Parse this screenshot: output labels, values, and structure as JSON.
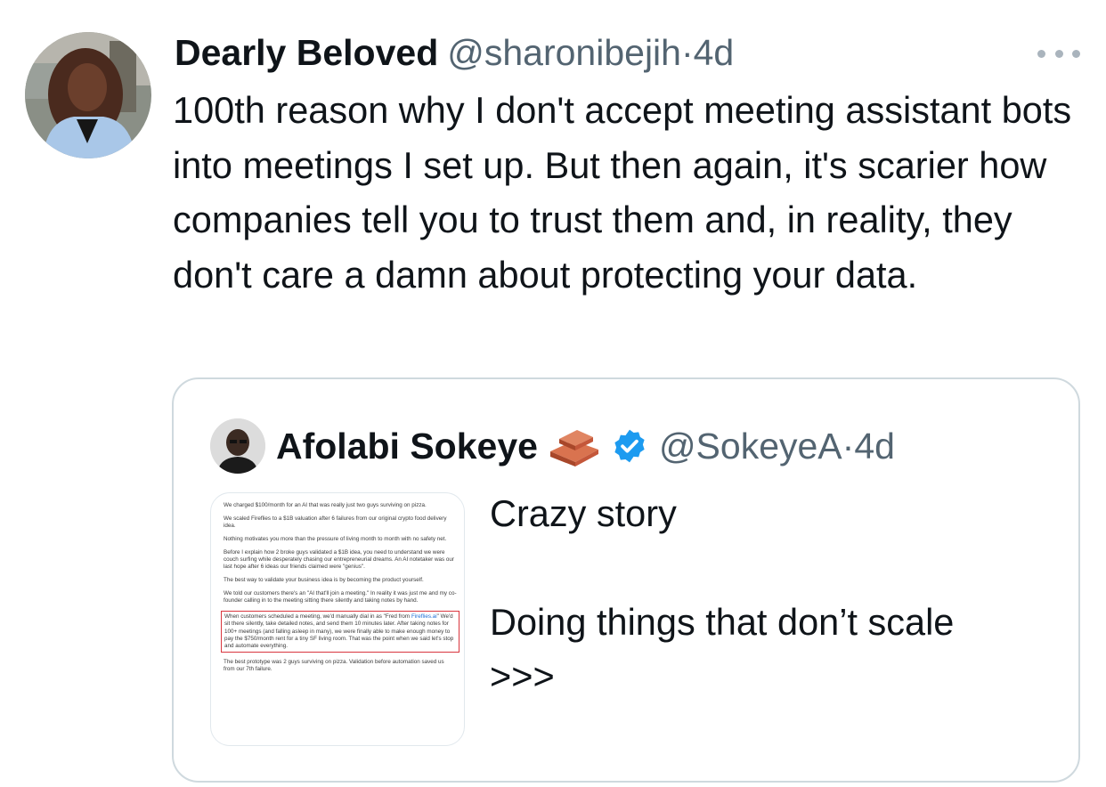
{
  "tweet": {
    "author_name": "Dearly Beloved",
    "handle": "@sharonibejih",
    "separator": "·",
    "time": "4d",
    "text": "100th reason why I don't accept meeting assistant bots into meetings I set up. But then again, it's scarier how companies tell you to trust them and, in reality, they don't care a damn about protecting your data.",
    "avatar_icon": "profile-photo-woman",
    "more_icon": "more-horizontal-icon"
  },
  "quoted_tweet": {
    "author_name": "Afolabi Sokeye",
    "emoji_icon": "bricks-emoji",
    "verified_icon": "verified-badge-icon",
    "verified_color": "#1d9bf0",
    "handle": "@SokeyeA",
    "separator": "·",
    "time": "4d",
    "text": "Crazy story\n\nDoing things that don’t scale\n>>>",
    "media": {
      "paragraphs": [
        "We charged $100/month for an AI that was really just two guys surviving on pizza.",
        "We scaled Fireflies to a $1B valuation after 6 failures from our original crypto food delivery idea.",
        "Nothing motivates you more than the pressure of living month to month with no safety net.",
        "Before I explain how 2 broke guys validated a $1B idea, you need to understand we were couch surfing while desperately chasing our entrepreneurial dreams. An AI notetaker was our last hope after 6 ideas our friends claimed were \"genius\".",
        "The best way to validate your business idea is by becoming the product yourself.",
        "We told our customers there's an \"AI that'll join a meeting.\" In reality it was just me and my co-founder calling in to the meeting sitting there silently and taking notes by hand."
      ],
      "highlight_before_link": "When customers scheduled a meeting, we'd manually dial in as \"Fred from ",
      "highlight_link": "Fireflies.ai",
      "highlight_after_link": "\" We'd sit there silently, take detailed notes, and send them 10 minutes later. After taking notes for 100+ meetings (and falling asleep in many), we were finally able to make enough money to pay the $750/month rent for a tiny SF living room. That was the point when we said let's stop and automate everything.",
      "last_paragraph": "The best prototype was 2 guys surviving on pizza. Validation before automation saved us from our 7th failure.",
      "highlight_color": "#d9363e",
      "link_color": "#1d6fd6"
    }
  }
}
